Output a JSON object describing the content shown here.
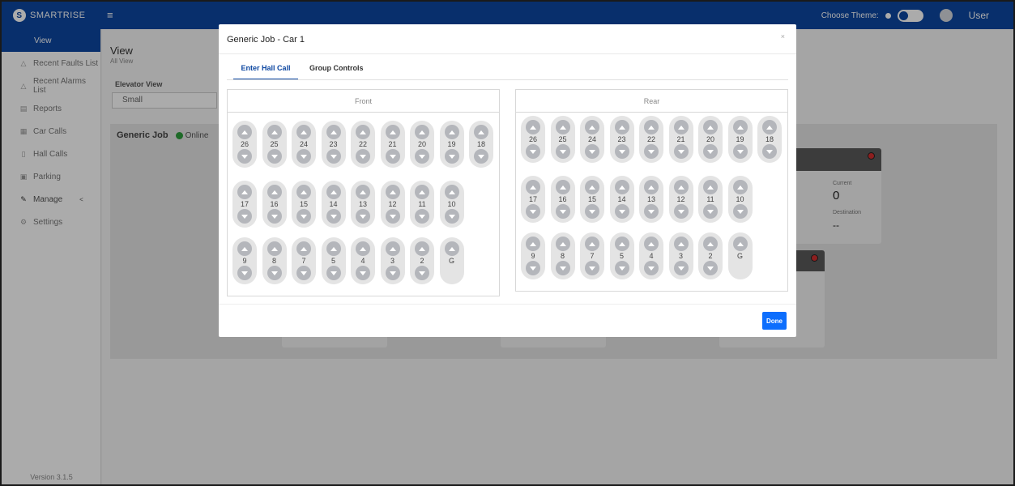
{
  "header": {
    "brand": "SMARTRISE",
    "menu_icon": "hamburger-icon",
    "theme_label": "Choose Theme:",
    "user": "User"
  },
  "sidebar": {
    "items": [
      {
        "label": "View",
        "icon": "view-icon",
        "active": true
      },
      {
        "label": "Recent Faults List",
        "icon": "warning-icon"
      },
      {
        "label": "Recent Alarms List",
        "icon": "alarm-icon"
      },
      {
        "label": "Reports",
        "icon": "report-icon"
      },
      {
        "label": "Car Calls",
        "icon": "car-icon"
      },
      {
        "label": "Hall Calls",
        "icon": "hall-icon"
      },
      {
        "label": "Parking",
        "icon": "parking-icon"
      },
      {
        "label": "Manage",
        "icon": "wrench-icon",
        "chevron": "<"
      },
      {
        "label": "Settings",
        "icon": "settings-icon"
      }
    ],
    "version": "Version 3.1.5"
  },
  "main": {
    "title": "View",
    "subtitle": "All View",
    "elevator_view_label": "Elevator View",
    "elevator_view_value": "Small",
    "job_name": "Generic Job",
    "job_status": "Online",
    "card_current_label": "Current",
    "card_current_value": "0",
    "card_destination_label": "Destination",
    "card_destination_value": "--"
  },
  "modal": {
    "title": "Generic Job - Car 1",
    "close": "×",
    "tabs": [
      {
        "label": "Enter Hall Call",
        "active": true
      },
      {
        "label": "Group Controls",
        "active": false
      }
    ],
    "front_label": "Front",
    "rear_label": "Rear",
    "floors_row1": [
      "26",
      "25",
      "24",
      "23",
      "22",
      "21",
      "20",
      "19",
      "18"
    ],
    "floors_row2": [
      "17",
      "16",
      "15",
      "14",
      "13",
      "12",
      "11",
      "10"
    ],
    "floors_row3": [
      "9",
      "8",
      "7",
      "5",
      "4",
      "3",
      "2",
      "G"
    ],
    "done_label": "Done"
  },
  "colors": {
    "brand": "#0d47a1",
    "primary_button": "#0d6efd",
    "online": "#2e9e3c",
    "hall_button": "#b4b6bb"
  }
}
